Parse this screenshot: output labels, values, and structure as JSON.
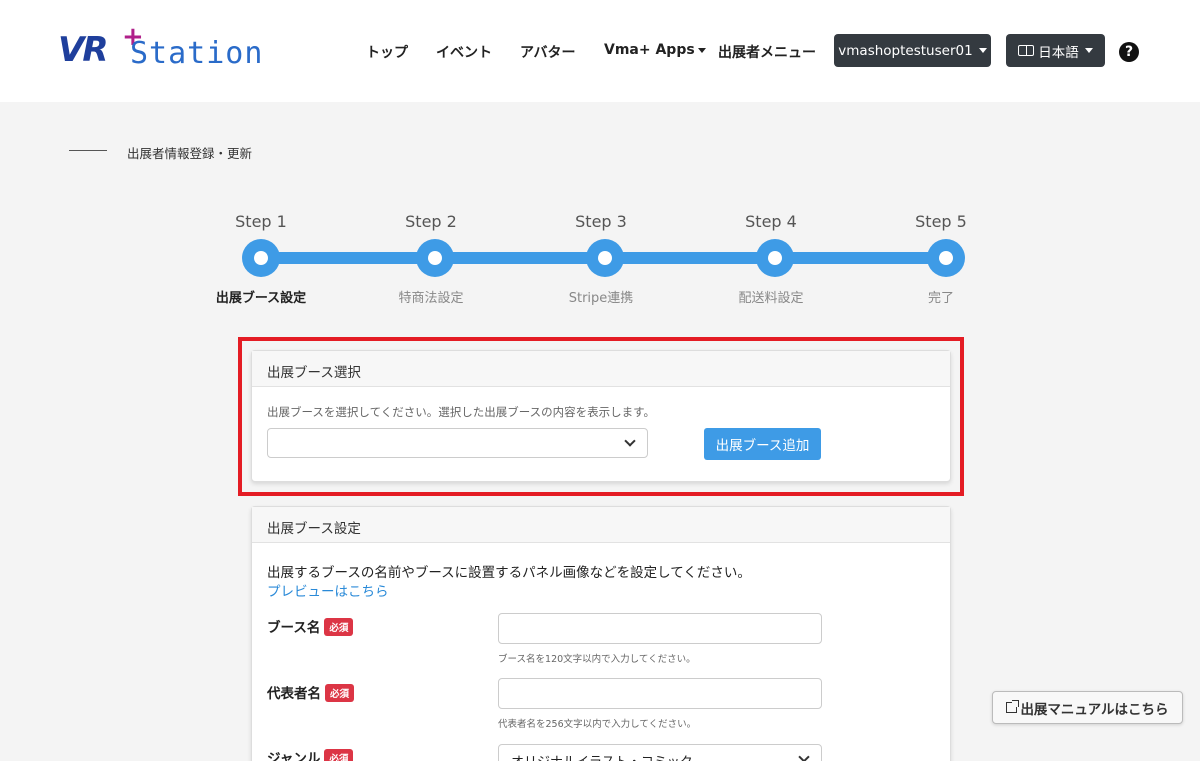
{
  "header": {
    "logo_vr": "VR",
    "logo_plus": "+",
    "logo_station": "Station",
    "nav": [
      {
        "label": "トップ"
      },
      {
        "label": "イベント"
      },
      {
        "label": "アバター"
      },
      {
        "label": "Vma+ Apps"
      },
      {
        "label": "出展者メニュー"
      }
    ],
    "user_label": "vmashoptestuser01",
    "lang_label": "日本語",
    "help_glyph": "?"
  },
  "breadcrumb": {
    "text": "出展者情報登録・更新"
  },
  "stepper": {
    "steps": [
      {
        "label": "Step 1",
        "sub": "出展ブース設定"
      },
      {
        "label": "Step 2",
        "sub": "特商法設定"
      },
      {
        "label": "Step 3",
        "sub": "Stripe連携"
      },
      {
        "label": "Step 4",
        "sub": "配送料設定"
      },
      {
        "label": "Step 5",
        "sub": "完了"
      }
    ],
    "active_index": 0
  },
  "booth_select": {
    "title": "出展ブース選択",
    "description": "出展ブースを選択してください。選択した出展ブースの内容を表示します。",
    "selected_value": "",
    "add_button": "出展ブース追加"
  },
  "booth_settings": {
    "title": "出展ブース設定",
    "description": "出展するブースの名前やブースに設置するパネル画像などを設定してください。",
    "preview_link": "プレビューはこちら",
    "required_badge": "必須",
    "fields": [
      {
        "label": "ブース名",
        "help": "ブース名を120文字以内で入力してください。",
        "value": ""
      },
      {
        "label": "代表者名",
        "help": "代表者名を256文字以内で入力してください。",
        "value": ""
      },
      {
        "label": "ジャンル",
        "value": "オリジナルイラスト・コミック"
      }
    ]
  },
  "manual_button": "出展マニュアルはこちら",
  "colors": {
    "accent": "#3e9be6",
    "highlight": "#e41c24",
    "required": "#dc3545",
    "dark": "#343a40"
  }
}
